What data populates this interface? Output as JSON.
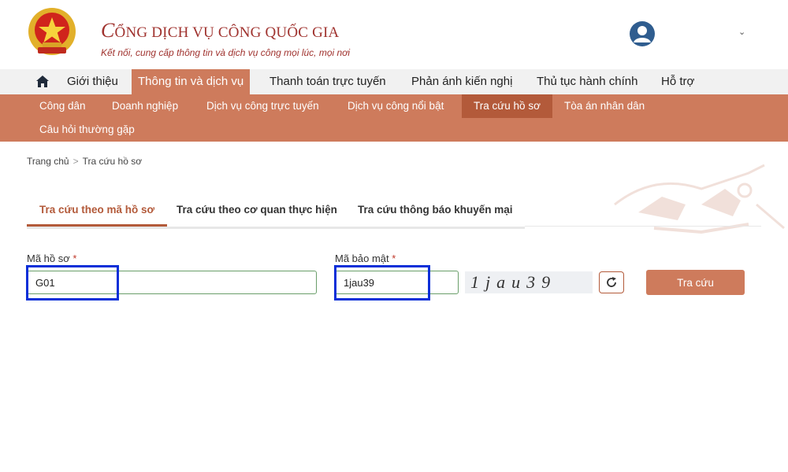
{
  "header": {
    "title_swirl": "C",
    "title_rest": "ỔNG DỊCH VỤ CÔNG QUỐC GIA",
    "subtitle": "Kết nối, cung cấp thông tin và dịch vụ công mọi lúc, mọi nơi",
    "emblem_icon": "national-emblem-icon",
    "user_icon": "user-avatar-icon",
    "brand_color": "#a0332f"
  },
  "main_nav": {
    "home_icon": "home-icon",
    "items": [
      "Giới thiệu",
      "Thông tin và dịch vụ",
      "Thanh toán trực tuyến",
      "Phản ánh kiến nghị",
      "Thủ tục hành chính",
      "Hỗ trợ"
    ],
    "active_index": 1
  },
  "sub_nav": {
    "items": [
      "Công dân",
      "Doanh nghiệp",
      "Dịch vụ công trực tuyến",
      "Dịch vụ công nổi bật",
      "Tra cứu hồ sơ",
      "Tòa án nhân dân",
      "Câu hỏi thường gặp"
    ],
    "active_index": 4,
    "bg_color": "#ce7b5c"
  },
  "breadcrumb": {
    "home": "Trang chủ",
    "separator": ">",
    "current": "Tra cứu hồ sơ"
  },
  "tabs": {
    "items": [
      "Tra cứu theo mã hồ sơ",
      "Tra cứu theo cơ quan thực hiện",
      "Tra cứu thông báo khuyến mại"
    ],
    "active_index": 0
  },
  "form": {
    "record_code": {
      "label": "Mã hồ sơ",
      "required_mark": "*",
      "value": "G01"
    },
    "security_code": {
      "label": "Mã bảo mật",
      "required_mark": "*",
      "value": "1jau39"
    },
    "captcha_text": "1jau39",
    "refresh_icon": "refresh-icon",
    "submit_label": "Tra cứu"
  },
  "colors": {
    "accent": "#ce7b5c",
    "accent_dark": "#b35a3a",
    "highlight": "#0a2fd8"
  }
}
